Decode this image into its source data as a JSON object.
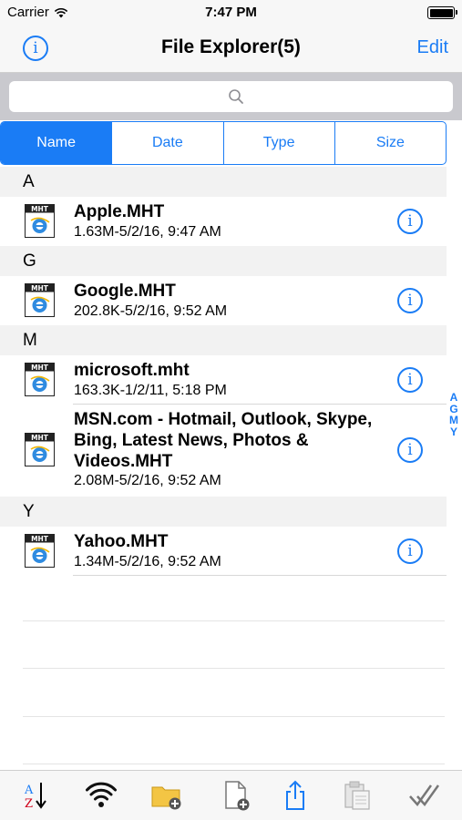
{
  "status_bar": {
    "carrier": "Carrier",
    "time": "7:47 PM"
  },
  "nav": {
    "title": "File Explorer(5)",
    "edit_label": "Edit",
    "info_glyph": "i"
  },
  "search": {
    "placeholder": ""
  },
  "sort_tabs": [
    {
      "label": "Name",
      "selected": true
    },
    {
      "label": "Date",
      "selected": false
    },
    {
      "label": "Type",
      "selected": false
    },
    {
      "label": "Size",
      "selected": false
    }
  ],
  "sections": [
    {
      "letter": "A",
      "files": [
        {
          "name": "Apple.MHT",
          "meta": "1.63M-5/2/16, 9:47 AM"
        }
      ]
    },
    {
      "letter": "G",
      "files": [
        {
          "name": "Google.MHT",
          "meta": "202.8K-5/2/16, 9:52 AM"
        }
      ]
    },
    {
      "letter": "M",
      "files": [
        {
          "name": "microsoft.mht",
          "meta": "163.3K-1/2/11, 5:18 PM"
        },
        {
          "name": "MSN.com - Hotmail, Outlook, Skype, Bing, Latest News, Photos & Videos.MHT",
          "meta": "2.08M-5/2/16, 9:52 AM"
        }
      ]
    },
    {
      "letter": "Y",
      "files": [
        {
          "name": "Yahoo.MHT",
          "meta": "1.34M-5/2/16, 9:52 AM"
        }
      ]
    }
  ],
  "file_icon_label": "MHT",
  "index_letters": [
    "A",
    "G",
    "M",
    "Y"
  ],
  "toolbar": {
    "items": [
      "sort-az-icon",
      "wifi-icon",
      "new-folder-icon",
      "new-file-icon",
      "share-icon",
      "paste-icon",
      "select-check-icon"
    ]
  },
  "colors": {
    "accent": "#1a7cf5",
    "ie_blue": "#2f8be0"
  }
}
